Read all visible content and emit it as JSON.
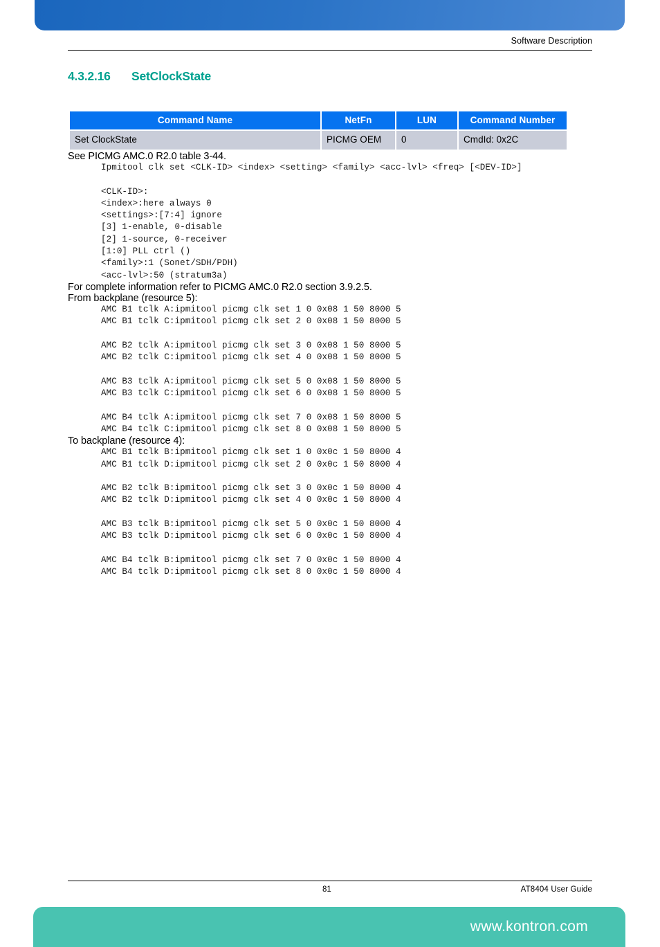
{
  "header": {
    "running_head": "Software Description"
  },
  "section": {
    "number": "4.3.2.16",
    "title": "SetClockState"
  },
  "command_table": {
    "columns": [
      "Command Name",
      "NetFn",
      "LUN",
      "Command Number"
    ],
    "rows": [
      [
        "Set ClockState",
        "PICMG OEM",
        "0",
        "CmdId: 0x2C"
      ]
    ]
  },
  "body": {
    "see_reference": "See PICMG AMC.0 R2.0 table 3-44.",
    "usage_code": "Ipmitool clk set <CLK-ID> <index> <setting> <family> <acc-lvl> <freq> [<DEV-ID>]\n\n<CLK-ID>:\n<index>:here always 0\n<settings>:[7:4] ignore\n[3] 1-enable, 0-disable\n[2] 1-source, 0-receiver\n[1:0] PLL ctrl ()\n<family>:1 (Sonet/SDH/PDH)\n<acc-lvl>:50 (stratum3a)",
    "complete_info": "For complete information refer to PICMG AMC.0 R2.0 section 3.9.2.5.",
    "from_backplane_label": "From backplane (resource 5):",
    "from_backplane_code": "AMC B1 tclk A:ipmitool picmg clk set 1 0 0x08 1 50 8000 5\nAMC B1 tclk C:ipmitool picmg clk set 2 0 0x08 1 50 8000 5\n\nAMC B2 tclk A:ipmitool picmg clk set 3 0 0x08 1 50 8000 5\nAMC B2 tclk C:ipmitool picmg clk set 4 0 0x08 1 50 8000 5\n\nAMC B3 tclk A:ipmitool picmg clk set 5 0 0x08 1 50 8000 5\nAMC B3 tclk C:ipmitool picmg clk set 6 0 0x08 1 50 8000 5\n\nAMC B4 tclk A:ipmitool picmg clk set 7 0 0x08 1 50 8000 5\nAMC B4 tclk C:ipmitool picmg clk set 8 0 0x08 1 50 8000 5",
    "to_backplane_label": "To backplane (resource 4):",
    "to_backplane_code": "AMC B1 tclk B:ipmitool picmg clk set 1 0 0x0c 1 50 8000 4\nAMC B1 tclk D:ipmitool picmg clk set 2 0 0x0c 1 50 8000 4\n\nAMC B2 tclk B:ipmitool picmg clk set 3 0 0x0c 1 50 8000 4\nAMC B2 tclk D:ipmitool picmg clk set 4 0 0x0c 1 50 8000 4\n\nAMC B3 tclk B:ipmitool picmg clk set 5 0 0x0c 1 50 8000 4\nAMC B3 tclk D:ipmitool picmg clk set 6 0 0x0c 1 50 8000 4\n\nAMC B4 tclk B:ipmitool picmg clk set 7 0 0x0c 1 50 8000 4\nAMC B4 tclk D:ipmitool picmg clk set 8 0 0x0c 1 50 8000 4"
  },
  "footer": {
    "page_number": "81",
    "guide_title": "AT8404 User  Guide",
    "website": "www.kontron.com"
  },
  "colors": {
    "heading_teal": "#00a18f",
    "table_header_blue": "#0673f0",
    "table_row_gray": "#c9cdd9",
    "top_banner_blue": "#2a73c6",
    "bottom_banner_teal": "#49c3b1"
  }
}
